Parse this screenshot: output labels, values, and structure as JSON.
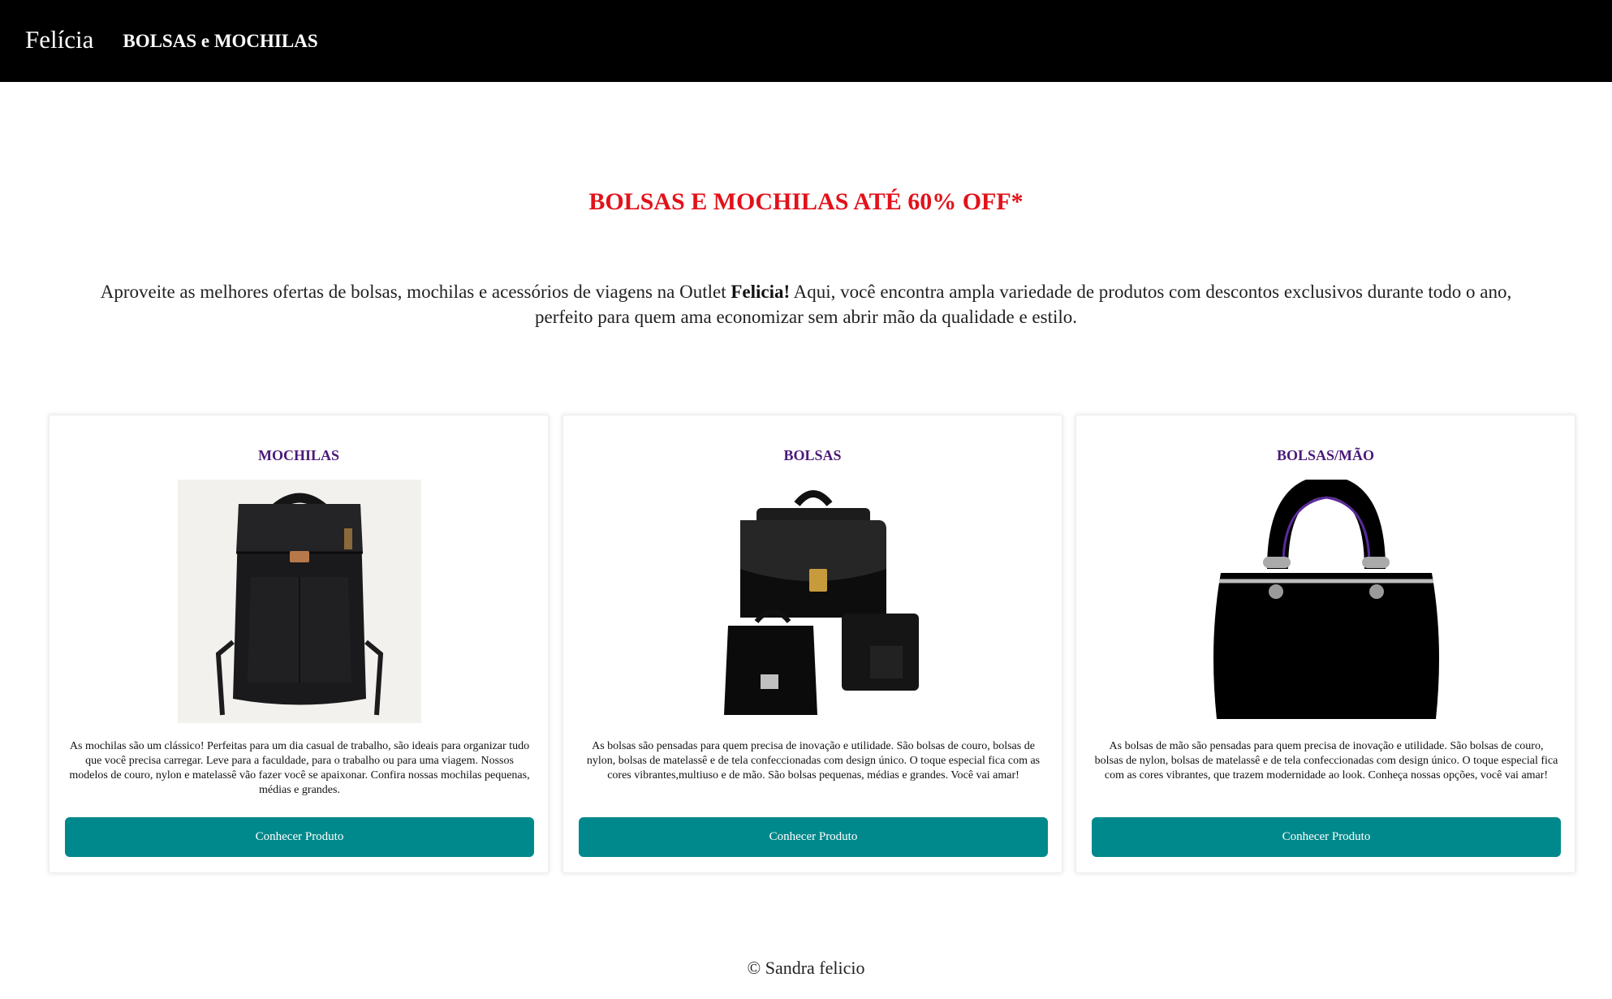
{
  "header": {
    "brand": "Felícia",
    "nav_link": "BOLSAS e MOCHILAS"
  },
  "main": {
    "promo_title": "BOLSAS E MOCHILAS ATÉ 60% OFF*",
    "intro_before": "Aproveite as melhores ofertas de bolsas, mochilas e acessórios de viagens na Outlet ",
    "intro_brand": "Felicia!",
    "intro_after": " Aqui, você encontra ampla variedade de produtos com descontos exclusivos durante todo o ano, perfeito para quem ama economizar sem abrir mão da qualidade e estilo."
  },
  "cards": [
    {
      "title": "MOCHILAS",
      "image": "backpack-image",
      "text": "As mochilas são um clássico! Perfeitas para um dia casual de trabalho, são ideais para organizar tudo que você precisa carregar. Leve para a faculdade, para o trabalho ou para uma viagem. Nossos modelos de couro, nylon e matelassê vão fazer você se apaixonar. Confira nossas mochilas pequenas, médias e grandes.",
      "button": "Conhecer Produto"
    },
    {
      "title": "BOLSAS",
      "image": "briefcase-image",
      "text": "As bolsas são pensadas para quem precisa de inovação e utilidade. São bolsas de couro, bolsas de nylon, bolsas de matelassê e de tela confeccionadas com design único. O toque especial fica com as cores vibrantes,multiuso e de mão. São bolsas pequenas, médias e grandes. Você vai amar!",
      "button": "Conhecer Produto"
    },
    {
      "title": "BOLSAS/MÃO",
      "image": "handbag-image",
      "text": "As bolsas de mão são pensadas para quem precisa de inovação e utilidade. São bolsas de couro, bolsas de nylon, bolsas de matelassê e de tela confeccionadas com design único. O toque especial fica com as cores vibrantes, que trazem modernidade ao look. Conheça nossas opções, você vai amar!",
      "button": "Conhecer Produto"
    }
  ],
  "footer": {
    "text": "© Sandra felicio"
  },
  "colors": {
    "header_bg": "#000000",
    "promo_red": "#e2121a",
    "card_title_purple": "#4b1a78",
    "button_teal": "#00898c"
  }
}
